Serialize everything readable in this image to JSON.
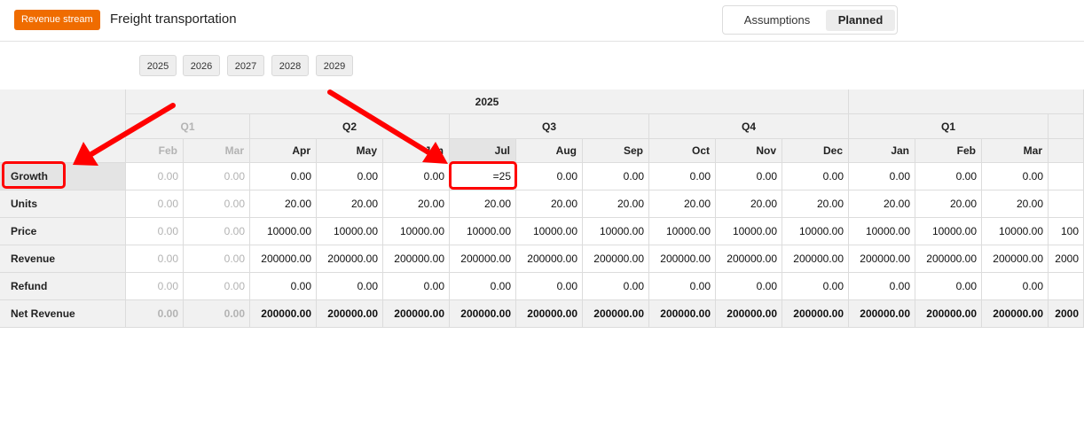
{
  "header": {
    "badge": "Revenue stream",
    "title": "Freight transportation",
    "toggle": {
      "assumptions": "Assumptions",
      "planned": "Planned",
      "active": "Planned"
    }
  },
  "years": [
    "2025",
    "2026",
    "2027",
    "2028",
    "2029"
  ],
  "table": {
    "year_header": "2025",
    "quarters": [
      {
        "label": "Q1",
        "dim": true
      },
      {
        "label": "Q2"
      },
      {
        "label": "Q3"
      },
      {
        "label": "Q4"
      },
      {
        "label": "Q1"
      }
    ],
    "months": [
      {
        "label": "Feb",
        "dim": true
      },
      {
        "label": "Mar",
        "dim": true
      },
      {
        "label": "Apr"
      },
      {
        "label": "May"
      },
      {
        "label": "Jun"
      },
      {
        "label": "Jul",
        "selected": true
      },
      {
        "label": "Aug"
      },
      {
        "label": "Sep"
      },
      {
        "label": "Oct"
      },
      {
        "label": "Nov"
      },
      {
        "label": "Dec"
      },
      {
        "label": "Jan"
      },
      {
        "label": "Feb"
      },
      {
        "label": "Mar"
      },
      {
        "label": ""
      }
    ],
    "rows": [
      {
        "label": "Growth",
        "values": [
          "0.00",
          "0.00",
          "0.00",
          "0.00",
          "0.00",
          "=25",
          "0.00",
          "0.00",
          "0.00",
          "0.00",
          "0.00",
          "0.00",
          "0.00",
          "0.00",
          ""
        ]
      },
      {
        "label": "Units",
        "values": [
          "0.00",
          "0.00",
          "20.00",
          "20.00",
          "20.00",
          "20.00",
          "20.00",
          "20.00",
          "20.00",
          "20.00",
          "20.00",
          "20.00",
          "20.00",
          "20.00",
          ""
        ]
      },
      {
        "label": "Price",
        "values": [
          "0.00",
          "0.00",
          "10000.00",
          "10000.00",
          "10000.00",
          "10000.00",
          "10000.00",
          "10000.00",
          "10000.00",
          "10000.00",
          "10000.00",
          "10000.00",
          "10000.00",
          "10000.00",
          "100"
        ]
      },
      {
        "label": "Revenue",
        "values": [
          "0.00",
          "0.00",
          "200000.00",
          "200000.00",
          "200000.00",
          "200000.00",
          "200000.00",
          "200000.00",
          "200000.00",
          "200000.00",
          "200000.00",
          "200000.00",
          "200000.00",
          "200000.00",
          "2000"
        ]
      },
      {
        "label": "Refund",
        "values": [
          "0.00",
          "0.00",
          "0.00",
          "0.00",
          "0.00",
          "0.00",
          "0.00",
          "0.00",
          "0.00",
          "0.00",
          "0.00",
          "0.00",
          "0.00",
          "0.00",
          ""
        ]
      },
      {
        "label": "Net Revenue",
        "bold": true,
        "values": [
          "0.00",
          "0.00",
          "200000.00",
          "200000.00",
          "200000.00",
          "200000.00",
          "200000.00",
          "200000.00",
          "200000.00",
          "200000.00",
          "200000.00",
          "200000.00",
          "200000.00",
          "200000.00",
          "2000"
        ]
      }
    ],
    "editing_cell": {
      "row": 0,
      "col": 5
    }
  },
  "colors": {
    "badge": "#ef6c00",
    "annotation": "#ff0000",
    "header_bg": "#f1f1f1"
  }
}
